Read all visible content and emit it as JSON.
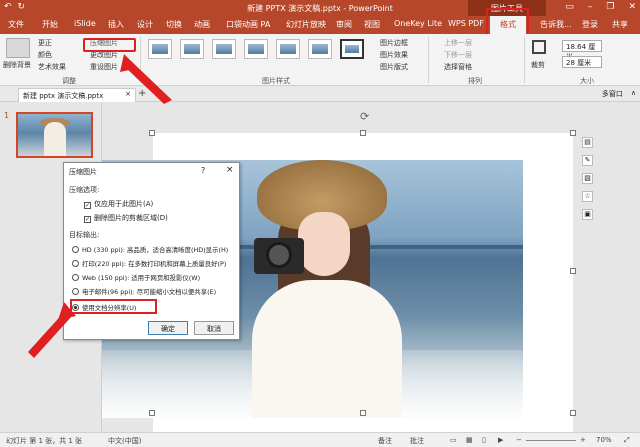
{
  "titlebar": {
    "title": "新建 PPTX 演示文稿.pptx - PowerPoint",
    "contextual": "图片工具",
    "qa_undo": "↶",
    "qa_redo": "↻"
  },
  "tabs": [
    "文件",
    "开始",
    "iSlide",
    "插入",
    "设计",
    "切换",
    "动画",
    "口袋动画 PA",
    "幻灯片放映",
    "审阅",
    "视图",
    "OneKey Lite",
    "WPS PDF",
    "格式",
    "告诉我...",
    "登录",
    "共享"
  ],
  "ribbon": {
    "remove_bg": "删除背景",
    "corrections": "更正",
    "color": "颜色",
    "artistic": "艺术效果",
    "compress": "压缩图片",
    "change": "更改图片",
    "reset": "重设图片",
    "adjust_group": "调整",
    "styles_group": "图片样式",
    "border": "图片边框",
    "effects": "图片效果",
    "layout": "图片版式",
    "forward": "上移一层",
    "backward": "下移一层",
    "selection": "选择窗格",
    "arrange_group": "排列",
    "crop": "裁剪",
    "height": "18.64 厘米",
    "width": "28 厘米",
    "size_group": "大小"
  },
  "docbar": {
    "tab_label": "新建 pptx 演示文稿.pptx",
    "tab_close": "×",
    "plus": "+",
    "multi_window": "多窗口",
    "collapse": "∧"
  },
  "thumbs": {
    "number": "1"
  },
  "dialog": {
    "title": "压缩图片",
    "help": "?",
    "close": "×",
    "section_compress": "压缩选项:",
    "opt_apply_one": "仅应用于此图片(A)",
    "opt_delete_crop": "删除图片的剪裁区域(D)",
    "section_output": "目标输出:",
    "res_hd": "HD (330 ppi): 高品质，适合高清晰度(HD)显示(H)",
    "res_print": "打印(220 ppi): 在多数打印机和屏幕上质量良好(P)",
    "res_web": "Web (150 ppi): 适用于网页和投影仪(W)",
    "res_email": "电子邮件(96 ppi): 尽可能缩小文档以便共享(E)",
    "res_doc": "使用文档分辨率(U)",
    "ok": "确定",
    "cancel": "取消"
  },
  "status": {
    "slide": "幻灯片 第 1 张，共 1 张",
    "lang": "中文(中国)",
    "notes": "备注",
    "comments": "批注",
    "zoom": "70%"
  }
}
